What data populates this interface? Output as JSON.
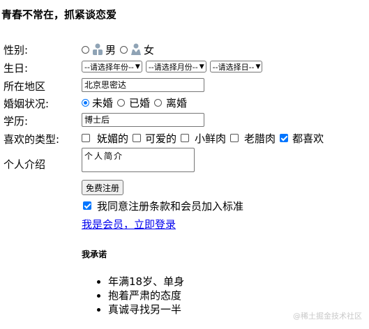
{
  "page_title": "青春不常在，抓紧谈恋爱",
  "gender": {
    "label": "性别:",
    "options": [
      {
        "label": "男",
        "icon": "male-user-icon",
        "selected": false
      },
      {
        "label": "女",
        "icon": "female-user-icon",
        "selected": false
      }
    ]
  },
  "birthday": {
    "label": "生日:",
    "year_placeholder": "--请选择年份--",
    "month_placeholder": "--请选择月份--",
    "day_placeholder": "--请选择日--"
  },
  "location": {
    "label": "所在地区",
    "value": "北京思密达"
  },
  "marital": {
    "label": "婚姻状况:",
    "options": [
      {
        "label": "未婚",
        "selected": true
      },
      {
        "label": "已婚",
        "selected": false
      },
      {
        "label": "离婚",
        "selected": false
      }
    ]
  },
  "education": {
    "label": "学历:",
    "value": "博士后"
  },
  "types": {
    "label": "喜欢的类型:",
    "options": [
      {
        "label": "妩媚的",
        "checked": false
      },
      {
        "label": "可爱的",
        "checked": false
      },
      {
        "label": "小鲜肉",
        "checked": false
      },
      {
        "label": "老腊肉",
        "checked": false
      },
      {
        "label": "都喜欢",
        "checked": true
      }
    ]
  },
  "intro": {
    "label": "个人介绍",
    "value": "个人简介"
  },
  "register_button": "免费注册",
  "agree": {
    "label": "我同意注册条款和会员加入标准",
    "checked": true
  },
  "login_link": "我是会员，立即登录",
  "pledge": {
    "title": "我承诺",
    "items": [
      "年满18岁、单身",
      "抱着严肃的态度",
      "真诚寻找另一半"
    ]
  },
  "watermark": "@稀土掘金技术社区",
  "colors": {
    "accent": "#0075ff",
    "link": "#0000ee"
  }
}
